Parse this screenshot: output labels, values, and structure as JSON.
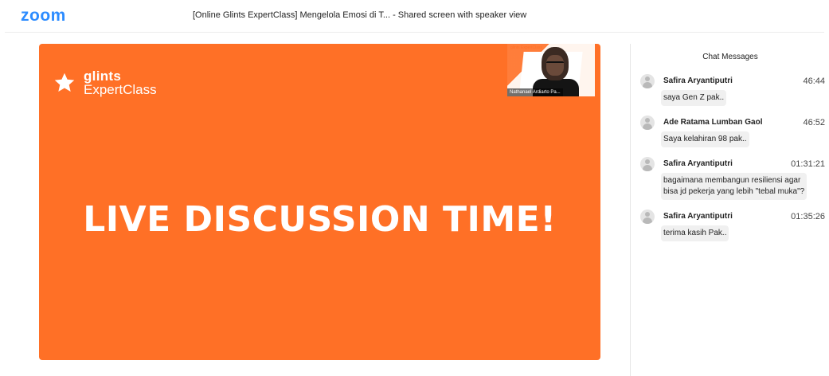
{
  "app": {
    "logo": "zoom",
    "window_title": "[Online Glints ExpertClass] Mengelola Emosi di T...",
    "window_subtitle": " - Shared screen with speaker view"
  },
  "colors": {
    "zoom_blue": "#2d8cff",
    "share_background": "#ff7026"
  },
  "share": {
    "brand_line1": "glints",
    "brand_line2": "ExpertClass",
    "brand_icon": "star-icon",
    "headline": "LIVE DISCUSSION TIME!",
    "speaker_thumb": {
      "brand": "glints ExpertClass",
      "name_tag": "Nathanael Ardiarto Pa..."
    }
  },
  "chat": {
    "title": "Chat Messages",
    "messages": [
      {
        "sender": "Safira Aryantiputri",
        "time": "46:44",
        "lines": [
          "saya Gen Z pak.."
        ]
      },
      {
        "sender": "Ade Ratama Lumban Gaol",
        "time": "46:52",
        "lines": [
          "Saya kelahiran 98 pak.."
        ]
      },
      {
        "sender": "Safira Aryantiputri",
        "time": "01:31:21",
        "lines": [
          "bagaimana membangun resiliensi agar",
          "bisa jd pekerja yang lebih \"tebal muka\"?"
        ]
      },
      {
        "sender": "Safira Aryantiputri",
        "time": "01:35:26",
        "lines": [
          "terima kasih Pak.."
        ]
      }
    ]
  }
}
